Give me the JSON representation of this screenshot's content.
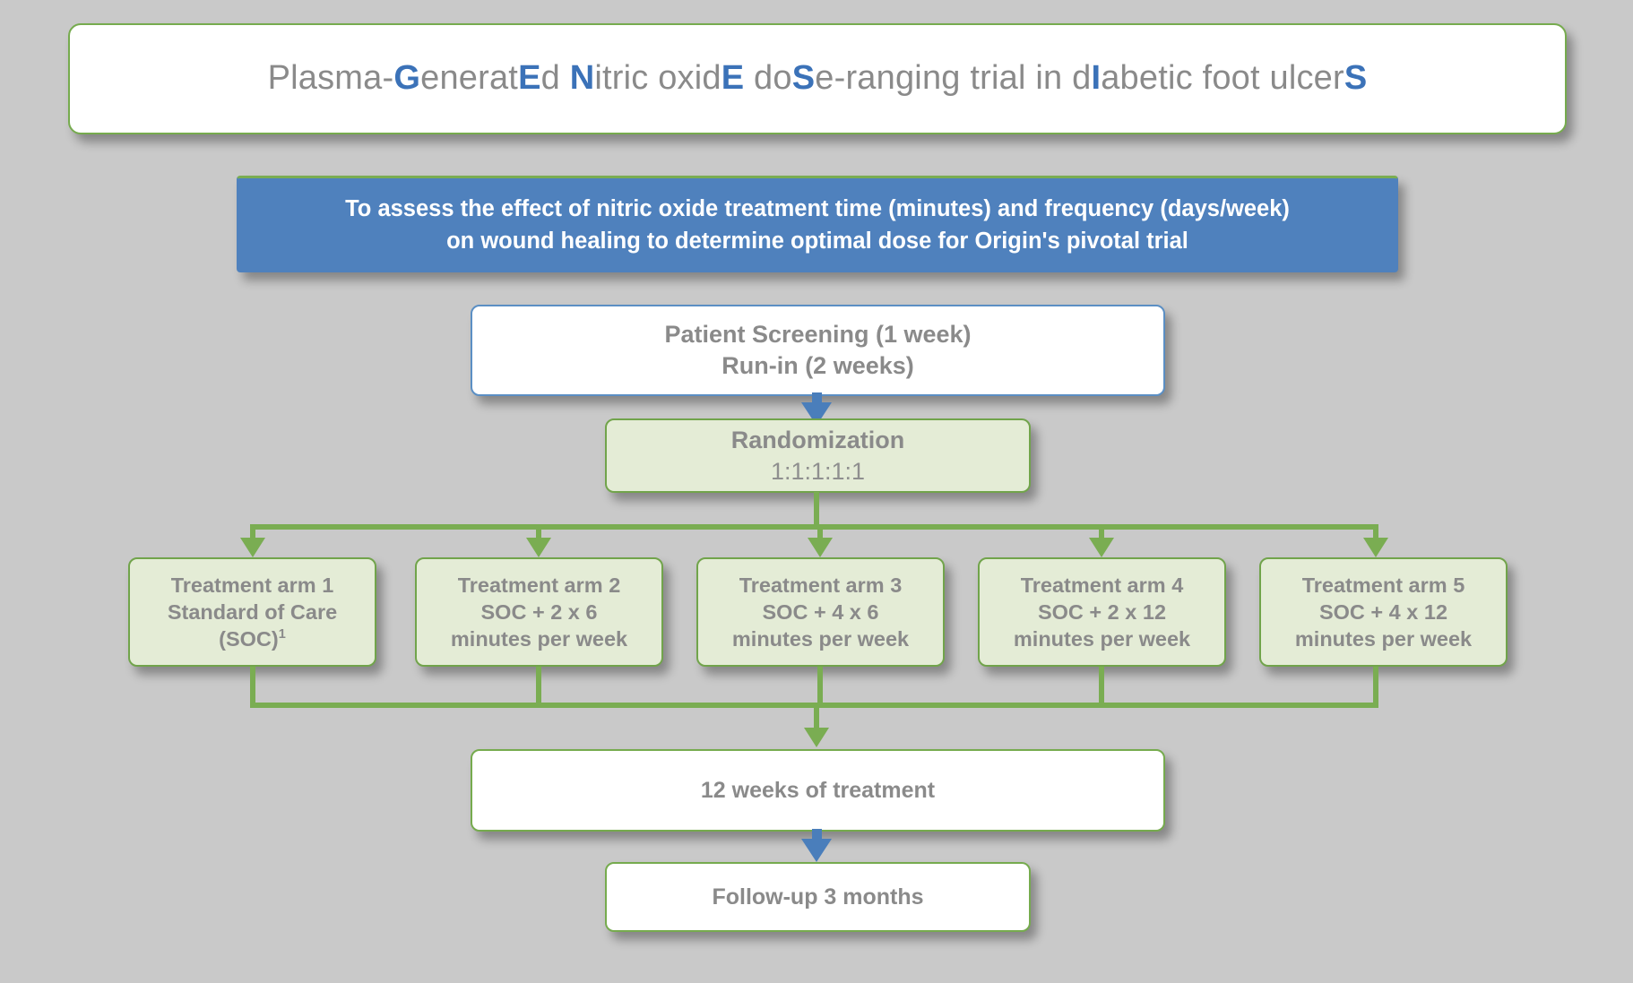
{
  "page": {
    "background_color": "#c9c9c9"
  },
  "colors": {
    "accent_blue": "#4f81bd",
    "arrow_blue": "#4a7ebb",
    "accent_green": "#7aad52",
    "box_green_border": "#71a44b",
    "box_green_fill": "#e4ecd6",
    "text_gray": "#8a8a8a",
    "white": "#ffffff"
  },
  "title": {
    "full_text": "Plasma-GeneratEd Nitric oxidE doSe-ranging trial in dIabetic foot ulcerS",
    "acronym": "GENESIS",
    "segments": [
      {
        "text": "Plasma-",
        "highlight": false
      },
      {
        "text": "G",
        "highlight": true
      },
      {
        "text": "enerat",
        "highlight": false
      },
      {
        "text": "E",
        "highlight": true
      },
      {
        "text": "d ",
        "highlight": false
      },
      {
        "text": "N",
        "highlight": true
      },
      {
        "text": "itric oxid",
        "highlight": false
      },
      {
        "text": "E",
        "highlight": true
      },
      {
        "text": " do",
        "highlight": false
      },
      {
        "text": "S",
        "highlight": true
      },
      {
        "text": "e-ranging trial in d",
        "highlight": false
      },
      {
        "text": "I",
        "highlight": true
      },
      {
        "text": "abetic foot ulcer",
        "highlight": false
      },
      {
        "text": "S",
        "highlight": true
      }
    ]
  },
  "objective": {
    "line1": "To assess the effect of nitric oxide treatment time (minutes) and frequency (days/week)",
    "line2": "on wound healing to determine optimal dose for Origin's pivotal trial"
  },
  "screening": {
    "line1": "Patient Screening (1 week)",
    "line2": "Run-in (2 weeks)"
  },
  "randomization": {
    "label": "Randomization",
    "ratio": "1:1:1:1:1"
  },
  "arms": [
    {
      "line1": "Treatment arm 1",
      "line2": "Standard of Care",
      "line3": "(SOC)",
      "footnote_marker": "1"
    },
    {
      "line1": "Treatment arm 2",
      "line2": "SOC + 2 x 6",
      "line3": "minutes per week",
      "footnote_marker": ""
    },
    {
      "line1": "Treatment arm 3",
      "line2": "SOC + 4 x 6",
      "line3": "minutes per week",
      "footnote_marker": ""
    },
    {
      "line1": "Treatment arm 4",
      "line2": "SOC + 2 x 12",
      "line3": "minutes per week",
      "footnote_marker": ""
    },
    {
      "line1": "Treatment arm 5",
      "line2": "SOC + 4 x 12",
      "line3": "minutes per week",
      "footnote_marker": ""
    }
  ],
  "treatment_period": {
    "label": "12 weeks of treatment"
  },
  "followup": {
    "label": "Follow-up 3 months"
  }
}
